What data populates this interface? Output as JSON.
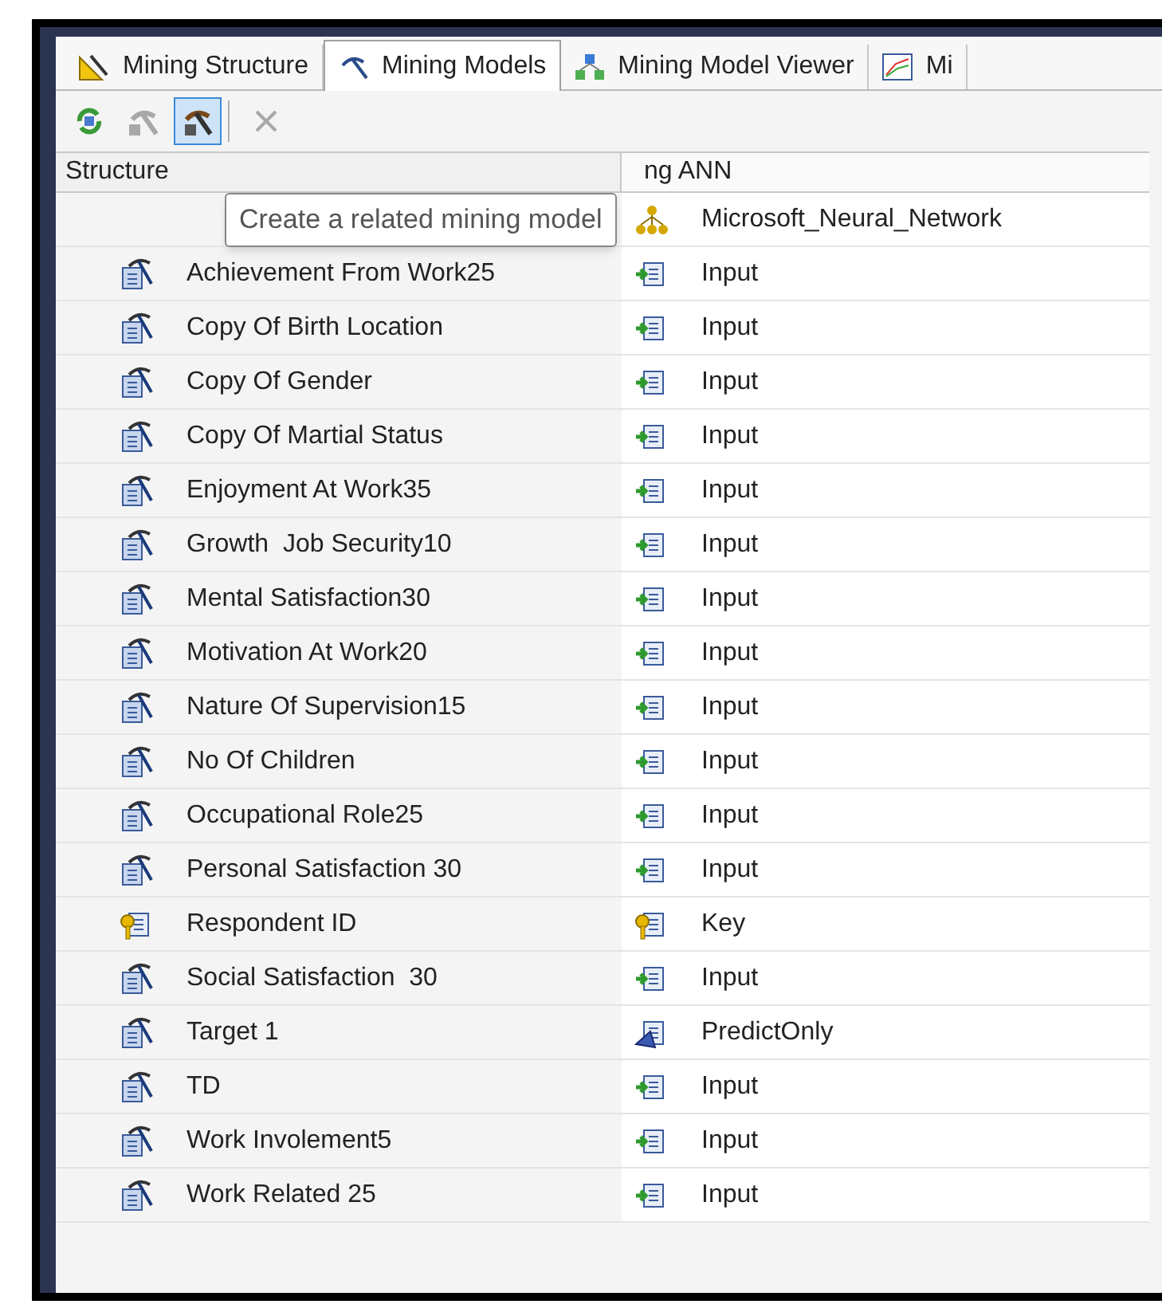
{
  "tabs": [
    {
      "label": "Mining Structure",
      "kind": "structure",
      "selected": false
    },
    {
      "label": "Mining Models",
      "kind": "models",
      "selected": true
    },
    {
      "label": "Mining Model Viewer",
      "kind": "viewer",
      "selected": false
    },
    {
      "label": "Mi",
      "kind": "chart",
      "selected": false
    }
  ],
  "toolbar": [
    {
      "kind": "refresh",
      "pressed": false,
      "disabled": false
    },
    {
      "kind": "model",
      "pressed": false,
      "disabled": true
    },
    {
      "kind": "related",
      "pressed": true,
      "disabled": false
    },
    {
      "kind": "delete",
      "pressed": false,
      "disabled": true
    }
  ],
  "tooltip": "Create a related mining model",
  "columns": [
    "Structure",
    "ng ANN"
  ],
  "rows": [
    {
      "usage": {
        "kind": "algorithm",
        "label": "Microsoft_Neural_Network"
      }
    },
    {
      "structure": {
        "kind": "column",
        "label": "Achievement From Work25"
      },
      "usage": {
        "kind": "input",
        "label": "Input"
      }
    },
    {
      "structure": {
        "kind": "column",
        "label": "Copy Of Birth Location"
      },
      "usage": {
        "kind": "input",
        "label": "Input"
      }
    },
    {
      "structure": {
        "kind": "column",
        "label": "Copy Of Gender"
      },
      "usage": {
        "kind": "input",
        "label": "Input"
      }
    },
    {
      "structure": {
        "kind": "column",
        "label": "Copy Of Martial Status"
      },
      "usage": {
        "kind": "input",
        "label": "Input"
      }
    },
    {
      "structure": {
        "kind": "column",
        "label": "Enjoyment At Work35"
      },
      "usage": {
        "kind": "input",
        "label": "Input"
      }
    },
    {
      "structure": {
        "kind": "column",
        "label": "Growth  Job Security10"
      },
      "usage": {
        "kind": "input",
        "label": "Input"
      }
    },
    {
      "structure": {
        "kind": "column",
        "label": "Mental Satisfaction30"
      },
      "usage": {
        "kind": "input",
        "label": "Input"
      }
    },
    {
      "structure": {
        "kind": "column",
        "label": "Motivation At Work20"
      },
      "usage": {
        "kind": "input",
        "label": "Input"
      }
    },
    {
      "structure": {
        "kind": "column",
        "label": "Nature Of Supervision15"
      },
      "usage": {
        "kind": "input",
        "label": "Input"
      }
    },
    {
      "structure": {
        "kind": "column",
        "label": "No Of Children"
      },
      "usage": {
        "kind": "input",
        "label": "Input"
      }
    },
    {
      "structure": {
        "kind": "column",
        "label": "Occupational Role25"
      },
      "usage": {
        "kind": "input",
        "label": "Input"
      }
    },
    {
      "structure": {
        "kind": "column",
        "label": "Personal Satisfaction 30"
      },
      "usage": {
        "kind": "input",
        "label": "Input"
      }
    },
    {
      "structure": {
        "kind": "key",
        "label": "Respondent ID"
      },
      "usage": {
        "kind": "key",
        "label": "Key"
      }
    },
    {
      "structure": {
        "kind": "column",
        "label": "Social Satisfaction  30"
      },
      "usage": {
        "kind": "input",
        "label": "Input"
      }
    },
    {
      "structure": {
        "kind": "column",
        "label": "Target 1"
      },
      "usage": {
        "kind": "predict",
        "label": "PredictOnly"
      }
    },
    {
      "structure": {
        "kind": "column",
        "label": "TD"
      },
      "usage": {
        "kind": "input",
        "label": "Input"
      }
    },
    {
      "structure": {
        "kind": "column",
        "label": "Work Involement5"
      },
      "usage": {
        "kind": "input",
        "label": "Input"
      }
    },
    {
      "structure": {
        "kind": "column",
        "label": "Work Related 25"
      },
      "usage": {
        "kind": "input",
        "label": "Input"
      }
    }
  ]
}
